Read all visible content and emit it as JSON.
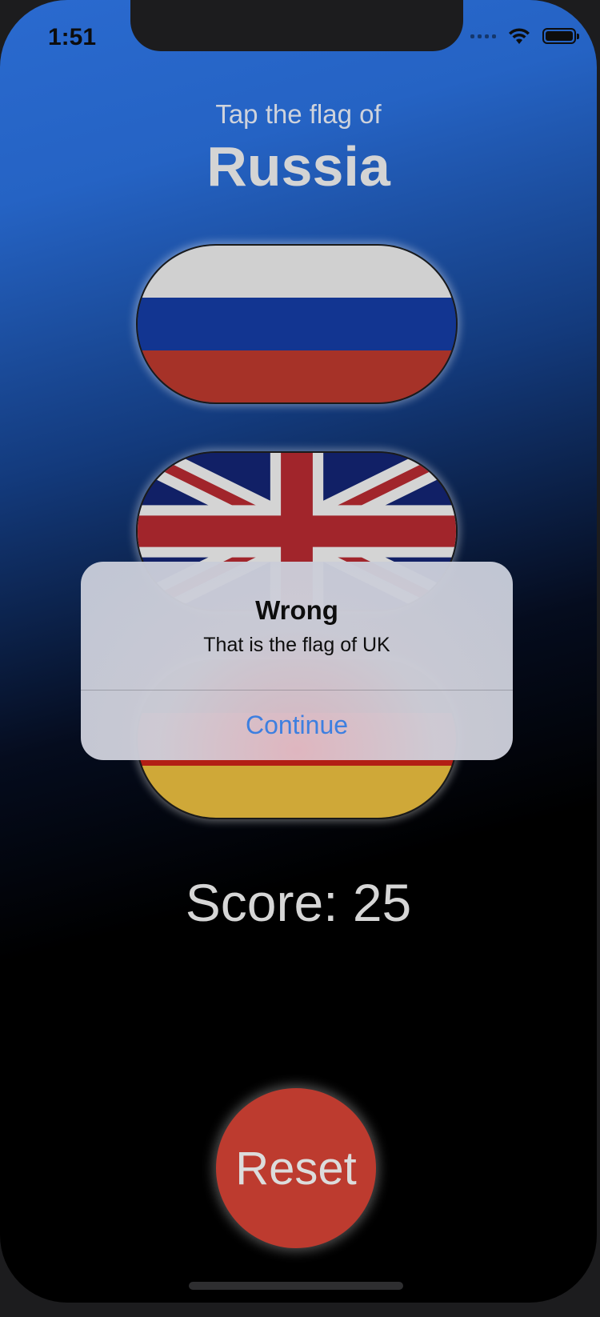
{
  "status_bar": {
    "time": "1:51"
  },
  "header": {
    "prompt": "Tap the flag of",
    "country": "Russia"
  },
  "flags": [
    {
      "name": "Russia",
      "stripes": [
        "#d0d0d0",
        "#123591",
        "#a63228"
      ]
    },
    {
      "name": "UK",
      "colors": {
        "blue": "#112066",
        "red": "#a1252b",
        "white": "#d4d4d4"
      }
    },
    {
      "name": "Germany",
      "stripes": [
        "#161616",
        "#b21e15",
        "#cfa838"
      ]
    }
  ],
  "score": {
    "text": "Score: 25"
  },
  "reset_button": {
    "label": "Reset",
    "color": "#bd3b2f"
  },
  "alert": {
    "title": "Wrong",
    "message": "That is the flag of UK",
    "button_label": "Continue",
    "button_color": "#3d7fe0"
  }
}
